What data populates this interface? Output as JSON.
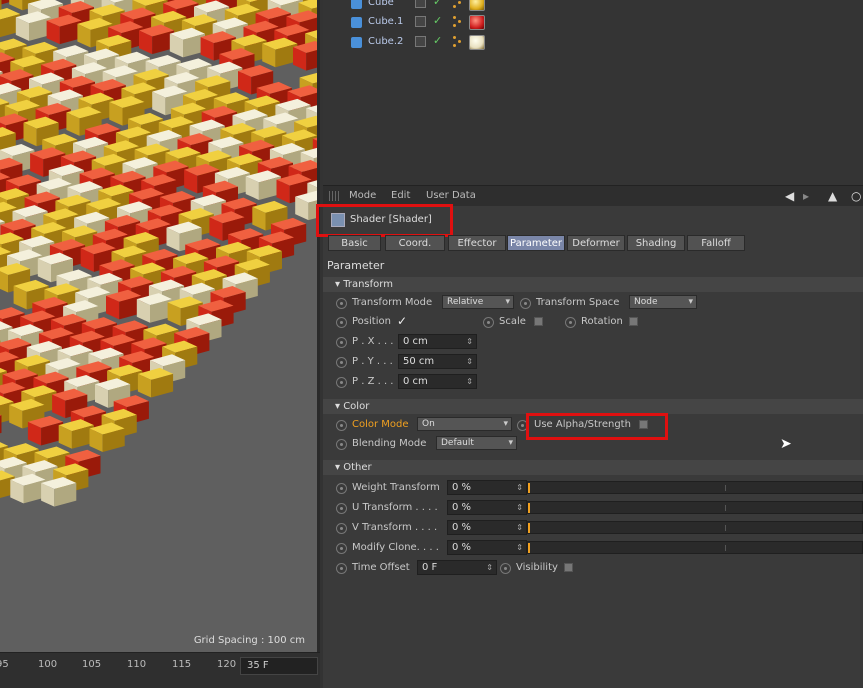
{
  "objects": [
    {
      "name": "Cube",
      "material": "#e0b020"
    },
    {
      "name": "Cube.1",
      "material": "#d02020"
    },
    {
      "name": "Cube.2",
      "material": "#e8e0c0"
    }
  ],
  "menu": {
    "mode": "Mode",
    "edit": "Edit",
    "user_data": "User Data"
  },
  "shader_title": "Shader [Shader]",
  "tabs": [
    "Basic",
    "Coord.",
    "Effector",
    "Parameter",
    "Deformer",
    "Shading",
    "Falloff"
  ],
  "active_tab": "Parameter",
  "param_heading": "Parameter",
  "transform": {
    "header": "Transform",
    "mode_label": "Transform Mode",
    "mode_value": "Relative",
    "space_label": "Transform Space",
    "space_value": "Node",
    "position_label": "Position",
    "position_check": "✓",
    "scale_label": "Scale",
    "rotation_label": "Rotation",
    "px_label": "P . X . . .",
    "px_value": "0 cm",
    "py_label": "P . Y . . .",
    "py_value": "50 cm",
    "pz_label": "P . Z . . .",
    "pz_value": "0 cm"
  },
  "color": {
    "header": "Color",
    "mode_label": "Color Mode",
    "mode_value": "On",
    "alpha_label": "Use Alpha/Strength",
    "blending_label": "Blending Mode",
    "blending_value": "Default"
  },
  "other": {
    "header": "Other",
    "weight_label": "Weight Transform",
    "weight_value": "0 %",
    "u_label": "U Transform . . . .",
    "u_value": "0 %",
    "v_label": "V Transform . . . .",
    "v_value": "0 %",
    "modify_label": "Modify Clone. . . .",
    "modify_value": "0 %",
    "time_label": "Time Offset",
    "time_value": "0 F",
    "visibility_label": "Visibility"
  },
  "viewport": {
    "grid_spacing": "Grid Spacing : 100 cm"
  },
  "timeline": {
    "ticks": [
      "95",
      "100",
      "105",
      "110",
      "115",
      "120"
    ],
    "frame": "35 F"
  },
  "colors": {
    "highlight": "#e01010",
    "accent": "#f0a020",
    "active_tab": "#7a86a8"
  }
}
